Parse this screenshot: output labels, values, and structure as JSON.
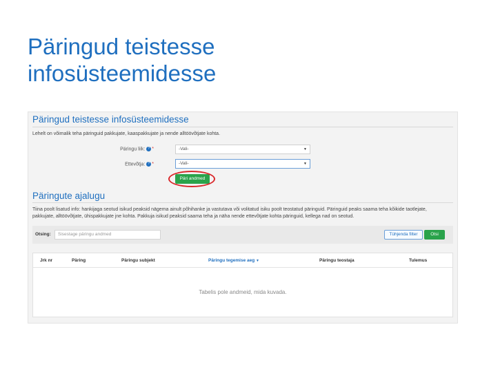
{
  "slide": {
    "title_line1": "Päringud teistesse",
    "title_line2": "infosüsteemidesse"
  },
  "app": {
    "section1": {
      "title": "Päringud teistesse infosüsteemidesse",
      "intro": "Lehelt on võimalik teha päringuid pakkujate, kaaspakkujate ja nende alltöövõtjate kohta."
    },
    "form": {
      "query_type_label": "Päringu liik:",
      "query_type_value": "-Vali-",
      "company_label": "Ettevõtja:",
      "company_value": "-Vali-",
      "submit_label": "Päri andmed"
    },
    "section2": {
      "title": "Päringute ajalugu",
      "text_line1": "Tiina poolt lisatud info: hankijaga seotud isikud peaksid nägema ainult põhihanke ja vastutava või volitatud isiku poolt teostatud päringuid. Päringuid peaks saama teha kõikide taotlejate,",
      "text_line2": "pakkujate, alltöövõtjate, ühispakkujate jne kohta. Pakkuja isikud peaksid saama teha ja näha nende ettevõtjate kohta päringuid, kellega nad on seotud."
    },
    "filter": {
      "label": "Otsing:",
      "placeholder": "Sisestage päringu andmed",
      "clear_label": "Tühjenda filter",
      "search_label": "Otsi"
    },
    "table": {
      "columns": [
        "Jrk nr",
        "Päring",
        "Päringu subjekt",
        "Päringu tegemise aeg",
        "Päringu teostaja",
        "Tulemus"
      ],
      "empty_message": "Tabelis pole andmeid, mida kuvada."
    }
  }
}
